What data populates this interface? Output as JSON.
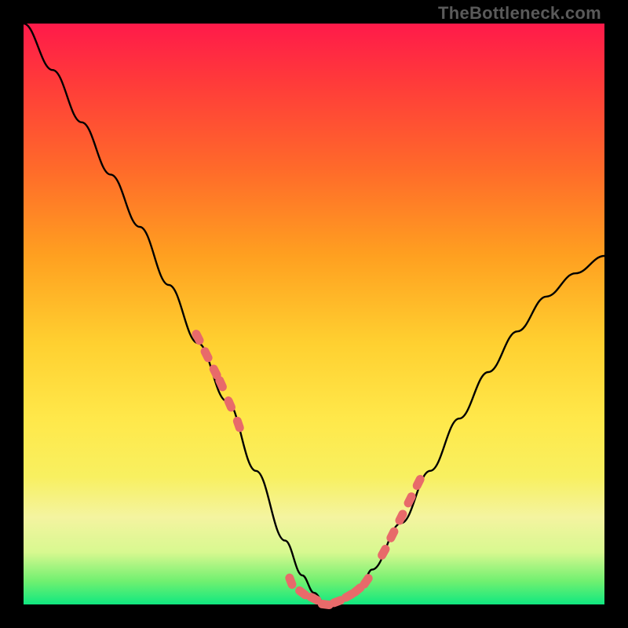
{
  "watermark": "TheBottleneck.com",
  "chart_data": {
    "type": "line",
    "title": "",
    "xlabel": "",
    "ylabel": "",
    "xlim": [
      0,
      100
    ],
    "ylim": [
      0,
      100
    ],
    "grid": false,
    "series": [
      {
        "name": "bottleneck-curve",
        "x": [
          0,
          5,
          10,
          15,
          20,
          25,
          30,
          35,
          40,
          45,
          48,
          50,
          52,
          54,
          56,
          58,
          60,
          65,
          70,
          75,
          80,
          85,
          90,
          95,
          100
        ],
        "values": [
          100,
          92,
          83,
          74,
          65,
          55,
          45,
          35,
          23,
          11,
          5,
          2,
          0,
          0,
          1,
          3,
          6,
          14,
          23,
          32,
          40,
          47,
          53,
          57,
          60
        ]
      }
    ],
    "markers": {
      "name": "highlighted-points",
      "x": [
        30,
        31.5,
        33,
        34,
        35.5,
        37,
        46,
        48,
        50,
        52,
        54,
        56,
        57.5,
        59,
        62,
        63.5,
        65,
        66.5,
        68
      ],
      "values": [
        46,
        43,
        40,
        38,
        34.5,
        31,
        4,
        2,
        1,
        0,
        0.5,
        1.5,
        2.5,
        4,
        9,
        12,
        15,
        18,
        21
      ]
    },
    "gradient_colors": {
      "top": "#ff1a4a",
      "mid_upper": "#ff9a20",
      "mid": "#ffe84a",
      "mid_lower": "#f4f4a0",
      "bottom": "#10e880"
    }
  }
}
